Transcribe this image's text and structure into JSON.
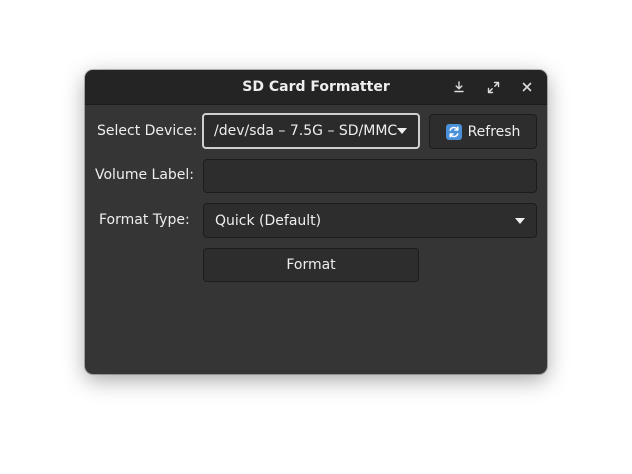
{
  "window": {
    "title": "SD Card Formatter",
    "titlebar_buttons": [
      "download-icon",
      "maximize-icon",
      "close-icon"
    ]
  },
  "form": {
    "device_label": "Select Device:",
    "device_value": "/dev/sda – 7.5G – SD/MMC",
    "refresh_label": "Refresh",
    "volume_label": "Volume Label:",
    "volume_value": "",
    "format_type_label": "Format Type:",
    "format_type_value": "Quick (Default)",
    "format_button": "Format"
  },
  "colors": {
    "window_bg": "#353535",
    "titlebar_bg": "#242424",
    "field_bg": "#2d2d2d",
    "text": "#eeeeee",
    "focus_border": "#cfcfcf",
    "refresh_icon": "#4a90d9"
  }
}
